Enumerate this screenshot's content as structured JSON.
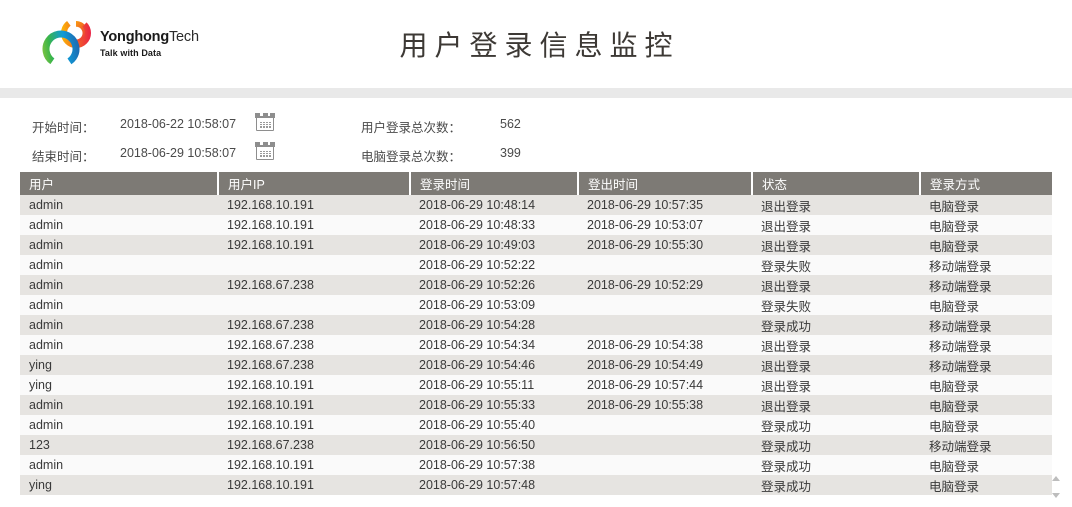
{
  "header": {
    "logo": {
      "name": "YonghongTech",
      "name_bold": "Yonghong",
      "name_light": "Tech",
      "tagline": "Talk with Data",
      "icon": "yonghong-logo-icon"
    },
    "title": "用户登录信息监控"
  },
  "filters": {
    "start_label": "开始时间：",
    "start_value": "2018-06-22 10:58:07",
    "end_label": "结束时间：",
    "end_value": "2018-06-29 10:58:07",
    "calendar_icon": "calendar-icon",
    "stats": [
      {
        "label": "用户登录总次数：",
        "value": "562"
      },
      {
        "label": "电脑登录总次数：",
        "value": "399"
      }
    ]
  },
  "table": {
    "columns": [
      "用户",
      "用户IP",
      "登录时间",
      "登出时间",
      "状态",
      "登录方式"
    ],
    "rows": [
      [
        "admin",
        "192.168.10.191",
        "2018-06-29 10:48:14",
        "2018-06-29 10:57:35",
        "退出登录",
        "电脑登录"
      ],
      [
        "admin",
        "192.168.10.191",
        "2018-06-29 10:48:33",
        "2018-06-29 10:53:07",
        "退出登录",
        "电脑登录"
      ],
      [
        "admin",
        "192.168.10.191",
        "2018-06-29 10:49:03",
        "2018-06-29 10:55:30",
        "退出登录",
        "电脑登录"
      ],
      [
        "admin",
        "",
        "2018-06-29 10:52:22",
        "",
        "登录失败",
        "移动端登录"
      ],
      [
        "admin",
        "192.168.67.238",
        "2018-06-29 10:52:26",
        "2018-06-29 10:52:29",
        "退出登录",
        "移动端登录"
      ],
      [
        "admin",
        "",
        "2018-06-29 10:53:09",
        "",
        "登录失败",
        "电脑登录"
      ],
      [
        "admin",
        "192.168.67.238",
        "2018-06-29 10:54:28",
        "",
        "登录成功",
        "移动端登录"
      ],
      [
        "admin",
        "192.168.67.238",
        "2018-06-29 10:54:34",
        "2018-06-29 10:54:38",
        "退出登录",
        "移动端登录"
      ],
      [
        "ying",
        "192.168.67.238",
        "2018-06-29 10:54:46",
        "2018-06-29 10:54:49",
        "退出登录",
        "移动端登录"
      ],
      [
        "ying",
        "192.168.10.191",
        "2018-06-29 10:55:11",
        "2018-06-29 10:57:44",
        "退出登录",
        "电脑登录"
      ],
      [
        "admin",
        "192.168.10.191",
        "2018-06-29 10:55:33",
        "2018-06-29 10:55:38",
        "退出登录",
        "电脑登录"
      ],
      [
        "admin",
        "192.168.10.191",
        "2018-06-29 10:55:40",
        "",
        "登录成功",
        "电脑登录"
      ],
      [
        "123",
        "192.168.67.238",
        "2018-06-29 10:56:50",
        "",
        "登录成功",
        "移动端登录"
      ],
      [
        "admin",
        "192.168.10.191",
        "2018-06-29 10:57:38",
        "",
        "登录成功",
        "电脑登录"
      ],
      [
        "ying",
        "192.168.10.191",
        "2018-06-29 10:57:48",
        "",
        "登录成功",
        "电脑登录"
      ]
    ]
  },
  "scroll": {
    "up_icon": "chevron-up-icon",
    "down_icon": "chevron-down-icon"
  },
  "colors": {
    "header_bar": "#7d7a75",
    "row_odd": "#e6e4e1",
    "row_even": "#fafafa",
    "band": "#e9e9e9",
    "title_text": "#3d3935"
  }
}
